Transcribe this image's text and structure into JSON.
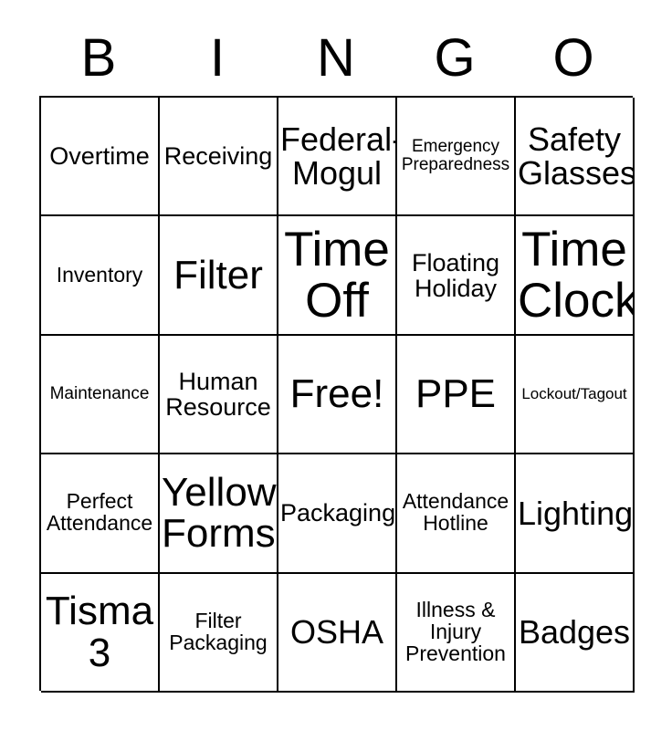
{
  "card": {
    "title": "BINGO",
    "header_letters": [
      "B",
      "I",
      "N",
      "G",
      "O"
    ],
    "rows": 5,
    "columns": 5,
    "free_space_label": "Free!",
    "colors": {
      "background": "#ffffff",
      "text": "#000000",
      "border": "#000000"
    },
    "squares": [
      {
        "label": "Overtime",
        "size": "md"
      },
      {
        "label": "Receiving",
        "size": "md"
      },
      {
        "label": "Federal-\nMogul",
        "size": "lg"
      },
      {
        "label": "Emergency\nPreparedness",
        "size": "xs"
      },
      {
        "label": "Safety\nGlasses",
        "size": "lg"
      },
      {
        "label": "Inventory",
        "size": "sm"
      },
      {
        "label": "Filter",
        "size": "xl"
      },
      {
        "label": "Time\nOff",
        "size": "xxl"
      },
      {
        "label": "Floating\nHoliday",
        "size": "md"
      },
      {
        "label": "Time\nClock",
        "size": "xxl"
      },
      {
        "label": "Maintenance",
        "size": "xs"
      },
      {
        "label": "Human\nResource",
        "size": "md"
      },
      {
        "label": "Free!",
        "size": "xl"
      },
      {
        "label": "PPE",
        "size": "xl"
      },
      {
        "label": "Lockout/Tagout",
        "size": "xxs"
      },
      {
        "label": "Perfect\nAttendance",
        "size": "sm"
      },
      {
        "label": "Yellow\nForms",
        "size": "xl"
      },
      {
        "label": "Packaging",
        "size": "md"
      },
      {
        "label": "Attendance\nHotline",
        "size": "sm"
      },
      {
        "label": "Lighting",
        "size": "lg"
      },
      {
        "label": "Tisma\n3",
        "size": "xl"
      },
      {
        "label": "Filter\nPackaging",
        "size": "sm"
      },
      {
        "label": "OSHA",
        "size": "lg"
      },
      {
        "label": "Illness &\nInjury\nPrevention",
        "size": "sm"
      },
      {
        "label": "Badges",
        "size": "lg"
      }
    ]
  }
}
